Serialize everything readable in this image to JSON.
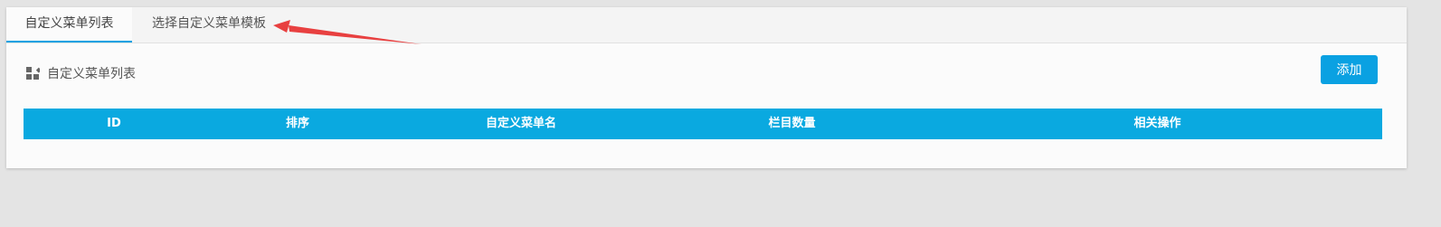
{
  "tabs": [
    {
      "label": "自定义菜单列表",
      "active": true
    },
    {
      "label": "选择自定义菜单模板",
      "active": false
    }
  ],
  "section": {
    "title": "自定义菜单列表",
    "icon": "grid-icon"
  },
  "toolbar": {
    "add_label": "添加"
  },
  "table": {
    "columns": [
      "ID",
      "排序",
      "自定义菜单名",
      "栏目数量",
      "相关操作"
    ]
  },
  "colors": {
    "accent": "#0aa1e2",
    "header_bg": "#0aa9e0",
    "annotation_arrow": "#e84040"
  }
}
